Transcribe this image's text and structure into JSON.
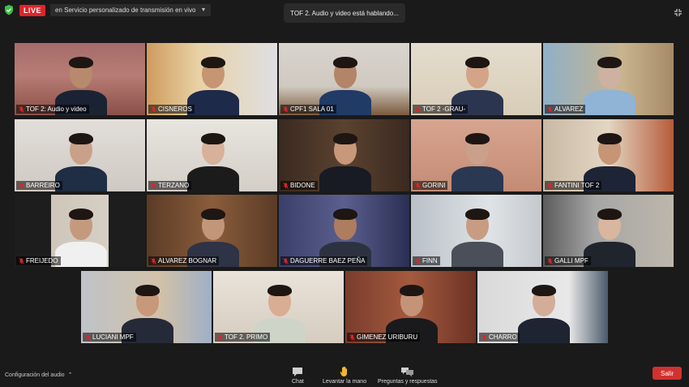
{
  "top_bar": {
    "live_label": "LIVE",
    "stream_select_value": "en Servicio personalizado de transmisión en vivo",
    "speaker_toast": "TOF 2. Audio y video está hablando..."
  },
  "participants": [
    "TOF 2: Audio y video",
    "CISNEROS",
    "CPF1 SALA 01",
    "TOF 2 -GRAU-",
    "ALVAREZ",
    "BARREIRO",
    "TERZANO",
    "BIDONE",
    "GORINI",
    "FANTINI TOF 2",
    "FREIJEDO",
    "ALVAREZ BOGNAR",
    "DAGUERRE BAEZ PEÑA",
    "FINN",
    "GALLI MPF",
    "LUCIANI MPF",
    "TOF 2. PRIMO",
    "GIMENEZ URIBURU",
    "CHARRO"
  ],
  "bottom_bar": {
    "audio_config_label": "Configuración del audio",
    "chat_label": "Chat",
    "raise_hand_label": "Levantar la mano",
    "qa_label": "Preguntas y respuestas",
    "leave_label": "Salir"
  },
  "colors": {
    "live": "#e0242a",
    "active_speaker_border": "#9bd23c",
    "leave_button": "#d1322f",
    "raise_hand": "#f2b630"
  }
}
